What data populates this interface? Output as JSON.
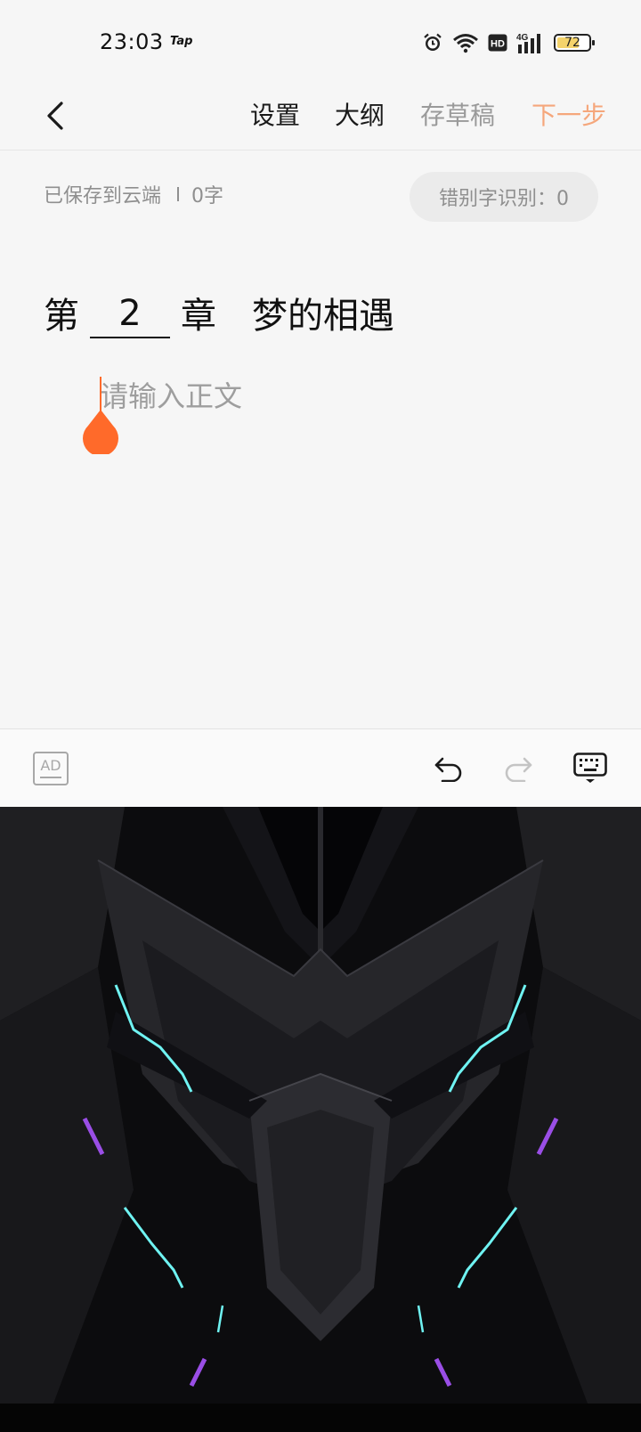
{
  "status_bar": {
    "time": "23:03",
    "app_tag": "Tap",
    "battery_level": "72",
    "battery_fraction": 0.72,
    "icons": [
      "alarm-icon",
      "wifi-icon",
      "hd-icon",
      "signal-4g-icon",
      "battery-icon"
    ],
    "hd_label": "HD",
    "network_label": "4G"
  },
  "nav": {
    "settings": "设置",
    "outline": "大纲",
    "draft": "存草稿",
    "next": "下一步",
    "back_icon": "chevron-left-icon"
  },
  "meta": {
    "save_status": "已保存到云端",
    "word_count": "0字",
    "typo_check": "错别字识别：0"
  },
  "chapter": {
    "prefix": "第",
    "number": "2",
    "suffix": "章",
    "title": "梦的相遇"
  },
  "editor": {
    "placeholder": "请输入正文"
  },
  "toolbar": {
    "ad_label": "AD",
    "undo_icon": "undo-icon",
    "redo_icon": "redo-icon",
    "keyboard_icon": "keyboard-hide-icon"
  },
  "colors": {
    "accent": "#ff6a2a",
    "next_disabled": "#f5a77c",
    "background": "#f6f6f6"
  }
}
